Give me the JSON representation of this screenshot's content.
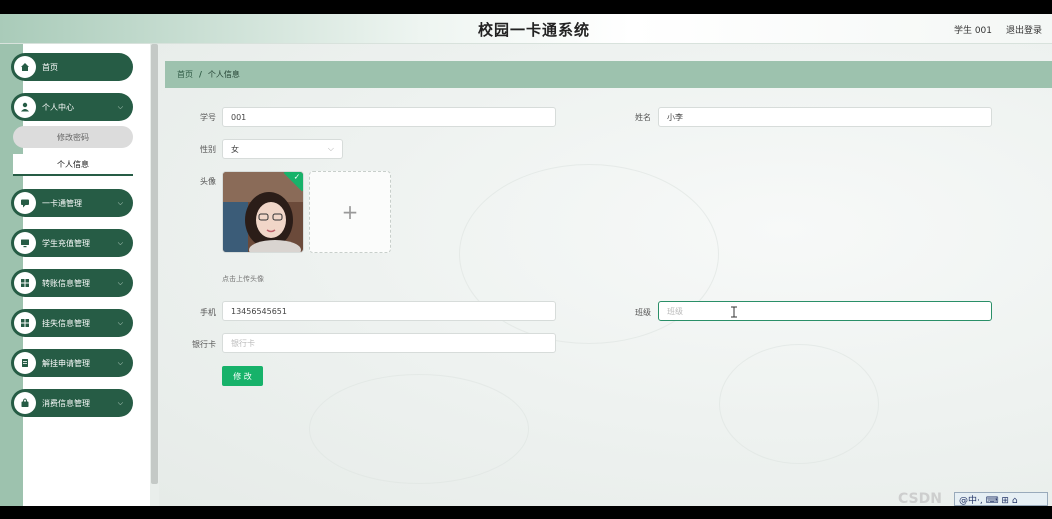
{
  "header": {
    "title": "校园一卡通系统",
    "user_text": "学生 001",
    "logout_label": "退出登录"
  },
  "sidebar": {
    "items": [
      {
        "label": "首页",
        "icon": "home-icon"
      },
      {
        "label": "个人中心",
        "icon": "user-icon"
      },
      {
        "label": "一卡通管理",
        "icon": "message-icon"
      },
      {
        "label": "学生充值管理",
        "icon": "monitor-icon"
      },
      {
        "label": "转账信息管理",
        "icon": "grid-icon"
      },
      {
        "label": "挂失信息管理",
        "icon": "grid-icon"
      },
      {
        "label": "解挂申请管理",
        "icon": "document-icon"
      },
      {
        "label": "消费信息管理",
        "icon": "bag-icon"
      }
    ],
    "sub_items": [
      {
        "label": "修改密码"
      },
      {
        "label": "个人信息"
      }
    ]
  },
  "breadcrumb": {
    "home": "首页",
    "separator": "/",
    "current": "个人信息"
  },
  "form": {
    "student_no_label": "学号",
    "student_no_value": "001",
    "name_label": "姓名",
    "name_value": "小李",
    "gender_label": "性别",
    "gender_value": "女",
    "avatar_label": "头像",
    "upload_tip": "点击上传头像",
    "phone_label": "手机",
    "phone_value": "13456545651",
    "class_label": "班级",
    "class_placeholder": "班级",
    "bank_card_label": "银行卡",
    "bank_card_placeholder": "银行卡",
    "submit_label": "修 改"
  },
  "overlay": {
    "watermark": "CSDN",
    "tray_text": "@中·, ⌨ ⊞ ⌂"
  },
  "colors": {
    "primary": "#265c45",
    "accent": "#17b26a",
    "breadcrumb_bg": "#9dc2ae"
  }
}
